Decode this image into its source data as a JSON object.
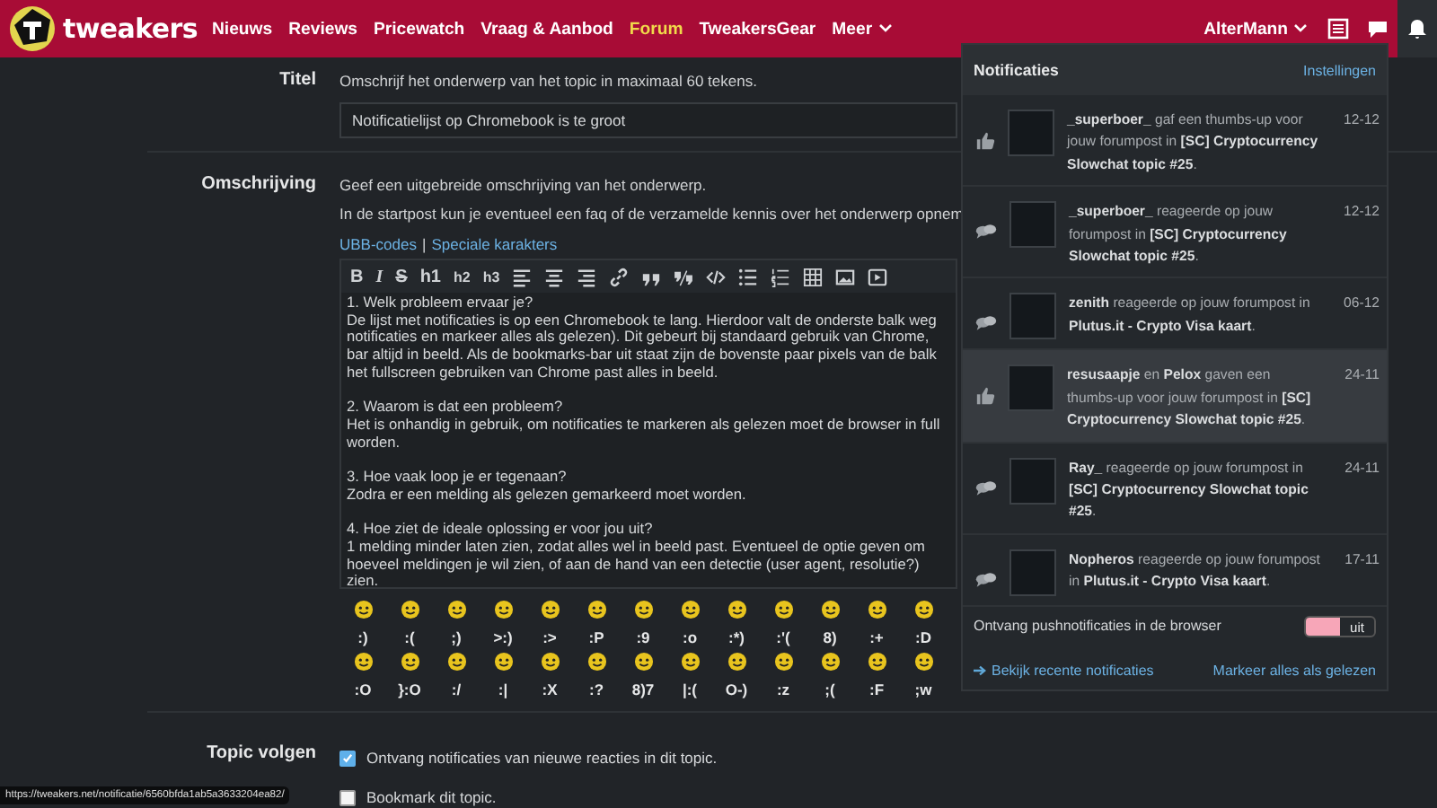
{
  "header": {
    "logo": "tweakers",
    "nav": [
      {
        "label": "Nieuws",
        "selected": false
      },
      {
        "label": "Reviews",
        "selected": false
      },
      {
        "label": "Pricewatch",
        "selected": false
      },
      {
        "label": "Vraag & Aanbod",
        "selected": false
      },
      {
        "label": "Forum",
        "selected": true
      },
      {
        "label": "TweakersGear",
        "selected": false
      },
      {
        "label": "Meer",
        "selected": false,
        "dropdown": true
      }
    ],
    "user": "AlterMann",
    "icons": [
      {
        "kind": "list",
        "selected": false
      },
      {
        "kind": "chat",
        "selected": false
      },
      {
        "kind": "bell",
        "selected": true
      }
    ]
  },
  "form": {
    "title": {
      "label": "Titel",
      "hint": "Omschrijf het onderwerp van het topic in maximaal 60 tekens.",
      "value": "Notificatielijst op Chromebook is te groot"
    },
    "description": {
      "label": "Omschrijving",
      "hints": [
        "Geef een uitgebreide omschrijving van het onderwerp.",
        "In de startpost kun je eventueel een faq of de verzamelde kennis over het onderwerp opnem"
      ],
      "links": [
        "UBB-codes",
        "Speciale karakters"
      ],
      "separator": "|",
      "toolbar": [
        {
          "kind": "text",
          "label": "B"
        },
        {
          "kind": "text",
          "label": "I"
        },
        {
          "kind": "text",
          "label": "S"
        },
        {
          "kind": "text",
          "label": "h1"
        },
        {
          "kind": "text",
          "label": "h2"
        },
        {
          "kind": "text",
          "label": "h3"
        },
        {
          "kind": "align-left"
        },
        {
          "kind": "align-center"
        },
        {
          "kind": "align-right"
        },
        {
          "kind": "link"
        },
        {
          "kind": "quote"
        },
        {
          "kind": "unquote"
        },
        {
          "kind": "code"
        },
        {
          "kind": "bullets"
        },
        {
          "kind": "numbers"
        },
        {
          "kind": "table"
        },
        {
          "kind": "image"
        },
        {
          "kind": "video"
        }
      ],
      "paragraphs": [
        [
          "1. Welk probleem ervaar je?",
          "De lijst met notificaties is op een Chromebook te lang. Hierdoor valt de onderste balk weg",
          "notificaties en markeer alles als gelezen). Dit gebeurt bij standaard gebruik van Chrome,",
          "bar altijd in beeld. Als de bookmarks-bar uit staat zijn de bovenste paar pixels van de balk",
          "het fullscreen gebruiken van Chrome past alles in beeld."
        ],
        [
          "2. Waarom is dat een probleem?",
          "Het is onhandig in gebruik, om notificaties te markeren als gelezen moet de browser in full",
          "worden."
        ],
        [
          "3. Hoe vaak loop je er tegenaan?",
          "Zodra er een melding als gelezen gemarkeerd moet worden."
        ],
        [
          "4. Hoe ziet de ideale oplossing er voor jou uit?",
          "1 melding minder laten zien, zodat alles wel in beeld past. Eventueel de optie geven om",
          "hoeveel meldingen je wil zien, of aan de hand van een detectie (user agent, resolutie?)",
          "zien."
        ]
      ],
      "smileys": [
        [
          ":)",
          ":(",
          ";)",
          ">:)",
          ":>",
          ":P",
          ":9",
          ":o",
          ":*)",
          ":'(",
          "8)",
          ":+",
          ":D"
        ],
        [
          ":O",
          "}:O",
          ":/",
          ":|",
          ":X",
          ":?",
          "8)7",
          "|:(",
          "O-)",
          ":z",
          ";(",
          ":F",
          ";w"
        ]
      ]
    },
    "follow": {
      "label": "Topic volgen",
      "options": [
        {
          "label": "Ontvang notificaties van nieuwe reacties in dit topic.",
          "checked": true
        },
        {
          "label": "Bookmark dit topic.",
          "checked": false
        }
      ]
    }
  },
  "notifications": {
    "title": "Notificaties",
    "settings": "Instellingen",
    "items": [
      {
        "kind": "thumbs-up",
        "text": "**_superboer_** gaf een thumbs-up voor jouw forumpost in **[SC] Cryptocurrency Slowchat topic #25**.",
        "date": "12-12",
        "highlighted": false
      },
      {
        "kind": "comment",
        "text": "**_superboer_** reageerde op jouw forumpost in **[SC] Cryptocurrency Slowchat topic #25**.",
        "date": "12-12",
        "highlighted": false
      },
      {
        "kind": "comment",
        "text": "**zenith** reageerde op jouw forumpost in **Plutus.it - Crypto Visa kaart**.",
        "date": "06-12",
        "highlighted": false
      },
      {
        "kind": "thumbs-up",
        "text": "**resusaapje** en **Pelox** gaven een thumbs-up voor jouw forumpost in **[SC] Cryptocurrency Slowchat topic #25**.",
        "date": "24-11",
        "highlighted": true
      },
      {
        "kind": "comment",
        "text": "**Ray_** reageerde op jouw forumpost in **[SC] Cryptocurrency Slowchat topic #25**.",
        "date": "24-11",
        "highlighted": false
      },
      {
        "kind": "comment",
        "text": "**Nopheros** reageerde op jouw forumpost in **Plutus.it - Crypto Visa kaart**.",
        "date": "17-11",
        "highlighted": false
      }
    ],
    "push": {
      "label": "Ontvang pushnotificaties in de browser",
      "on": false,
      "state": "uit"
    },
    "recent": "Bekijk recente notificaties",
    "mark_all": "Markeer alles als gelezen"
  },
  "status_url": "https://tweakers.net/notificatie/6560bfda1ab5a3633204ea82/"
}
